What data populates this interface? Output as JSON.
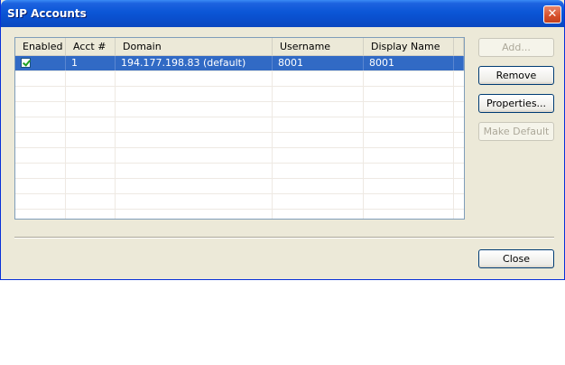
{
  "window": {
    "title": "SIP Accounts",
    "close_glyph": "✕"
  },
  "table": {
    "columns": [
      "Enabled",
      "Acct #",
      "Domain",
      "Username",
      "Display Name"
    ],
    "rows": [
      {
        "enabled": true,
        "acct": "1",
        "domain": "194.177.198.83 (default)",
        "username": "8001",
        "display_name": "8001",
        "selected": true
      }
    ]
  },
  "buttons": {
    "add": "Add...",
    "remove": "Remove",
    "properties": "Properties...",
    "make_default": "Make Default",
    "close": "Close"
  },
  "colors": {
    "selection": "#316ac5",
    "titlebar": "#0a4fcd",
    "dialog_bg": "#ece9d8"
  }
}
